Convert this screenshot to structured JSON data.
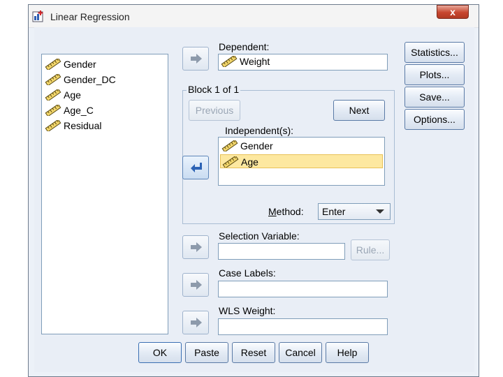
{
  "window": {
    "title": "Linear Regression",
    "close_label": "x"
  },
  "variables": {
    "items": [
      "Gender",
      "Gender_DC",
      "Age",
      "Age_C",
      "Residual"
    ]
  },
  "dependent": {
    "label": "Dependent:",
    "value": "Weight"
  },
  "block": {
    "legend": "Block 1 of 1",
    "previous_label": "Previous",
    "next_label": "Next"
  },
  "independent": {
    "label": "Independent(s):",
    "items": [
      "Gender",
      "Age"
    ],
    "selected_index": 1
  },
  "method": {
    "label": "Method:",
    "value": "Enter"
  },
  "selection": {
    "label": "Selection Variable:",
    "rule_label": "Rule..."
  },
  "case_labels": {
    "label": "Case Labels:"
  },
  "wls": {
    "label": "WLS Weight:"
  },
  "side_buttons": {
    "statistics": "Statistics...",
    "plots": "Plots...",
    "save": "Save...",
    "options": "Options..."
  },
  "bottom_buttons": {
    "ok": "OK",
    "paste": "Paste",
    "reset": "Reset",
    "cancel": "Cancel",
    "help": "Help"
  },
  "colors": {
    "selection_highlight": "#fde8a0",
    "window_bg": "#e9eef6",
    "close_red": "#c7462f"
  },
  "icons": {
    "variable": "scale-ruler-icon",
    "arrow_right": "arrow-right-icon",
    "arrow_left": "arrow-left-icon"
  }
}
